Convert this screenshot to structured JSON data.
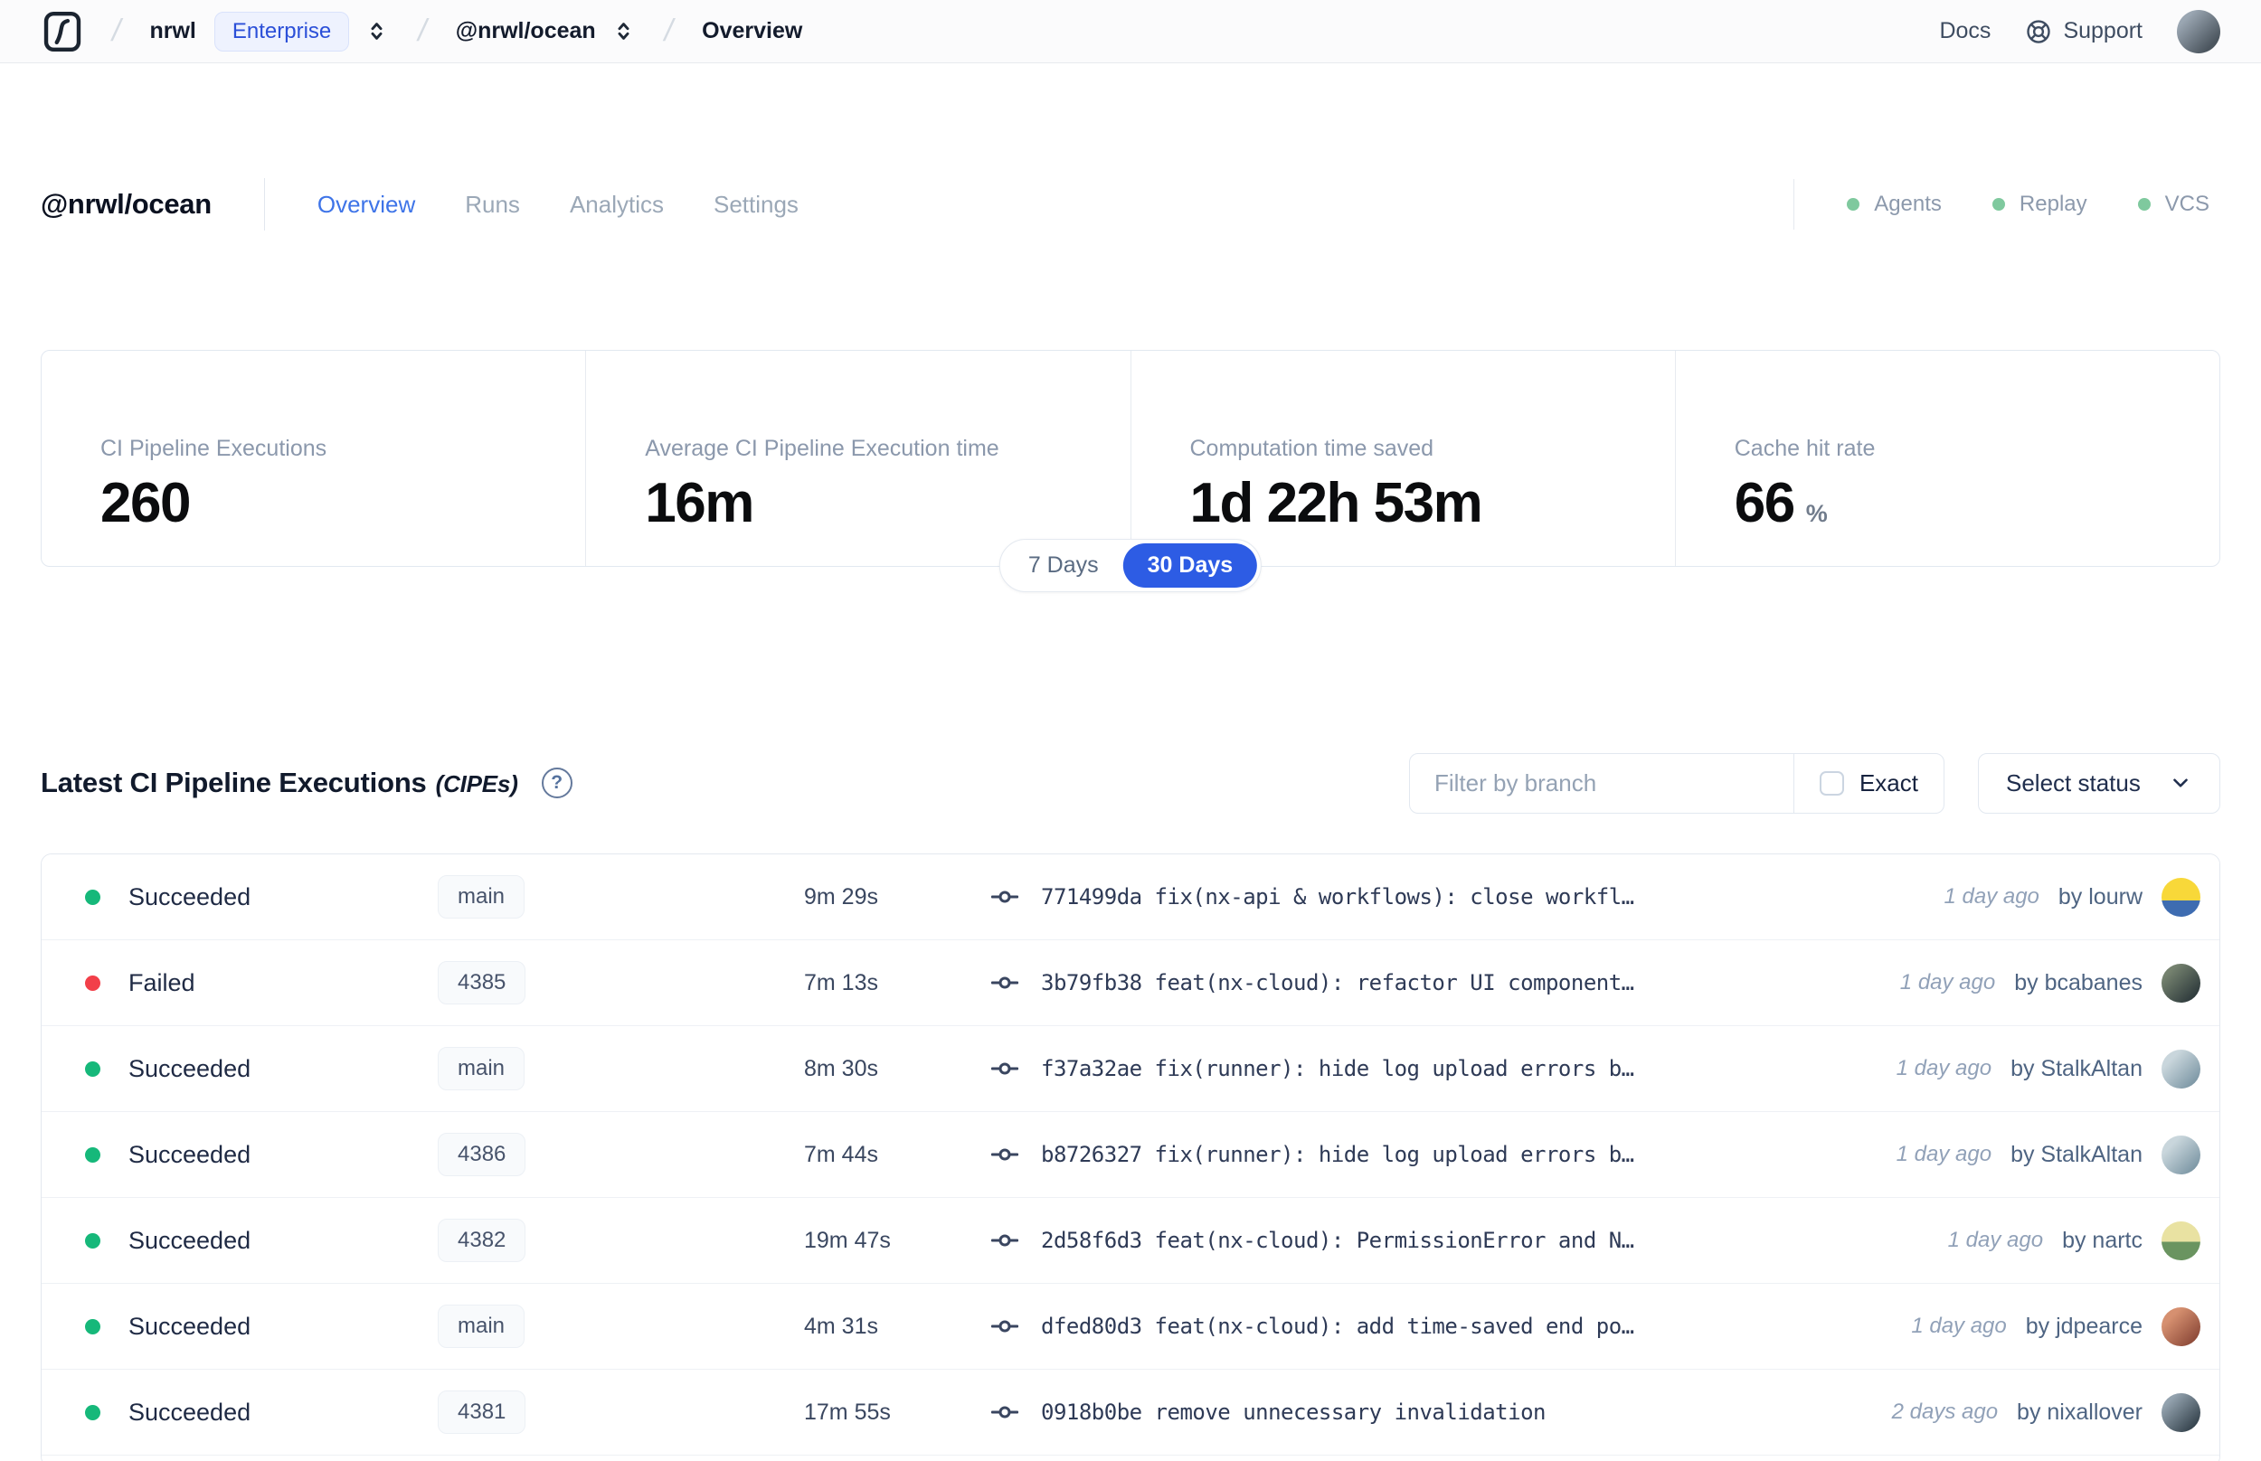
{
  "navbar": {
    "org": "nrwl",
    "org_badge": "Enterprise",
    "workspace": "@nrwl/ocean",
    "page": "Overview",
    "docs_label": "Docs",
    "support_label": "Support"
  },
  "workspace_header": {
    "title": "@nrwl/ocean",
    "tabs": [
      {
        "label": "Overview"
      },
      {
        "label": "Runs"
      },
      {
        "label": "Analytics"
      },
      {
        "label": "Settings"
      }
    ],
    "integrations": [
      {
        "label": "Agents"
      },
      {
        "label": "Replay"
      },
      {
        "label": "VCS"
      }
    ]
  },
  "stats": [
    {
      "label": "CI Pipeline Executions",
      "value": "260"
    },
    {
      "label": "Average CI Pipeline Execution time",
      "value": "16m"
    },
    {
      "label": "Computation time saved",
      "value": "1d 22h 53m"
    },
    {
      "label": "Cache hit rate",
      "value": "66",
      "suffix": "%"
    }
  ],
  "time_toggle": {
    "option_7": "7 Days",
    "option_30": "30 Days",
    "selected": "30 Days"
  },
  "cipe": {
    "title": "Latest CI Pipeline Executions",
    "title_suffix": "(CIPEs)",
    "filter_placeholder": "Filter by branch",
    "exact_label": "Exact",
    "select_status_label": "Select status"
  },
  "table": {
    "rows": [
      {
        "status": "Succeeded",
        "dot_style": "background:#16B87A",
        "branch": "main",
        "duration": "9m 29s",
        "commit_hash": "771499da",
        "commit_message": "fix(nx-api & workflows): close workfl…",
        "time": "1 day ago",
        "author": "by lourw",
        "avatar_style": "background:linear-gradient(180deg,#F8D839 58%,#3E6CB1 58%)"
      },
      {
        "status": "Failed",
        "dot_style": "background:#F23F49",
        "branch": "4385",
        "duration": "7m 13s",
        "commit_hash": "3b79fb38",
        "commit_message": "feat(nx-cloud): refactor UI component…",
        "time": "1 day ago",
        "author": "by bcabanes",
        "avatar_style": "background:linear-gradient(135deg,#75826F 20%,#2E3A3C 85%)"
      },
      {
        "status": "Succeeded",
        "dot_style": "background:#16B87A",
        "branch": "main",
        "duration": "8m 30s",
        "commit_hash": "f37a32ae",
        "commit_message": "fix(runner): hide log upload errors b…",
        "time": "1 day ago",
        "author": "by StalkAltan",
        "avatar_style": "background:linear-gradient(135deg,#C9D6DC 25%,#7E98A6 85%)"
      },
      {
        "status": "Succeeded",
        "dot_style": "background:#16B87A",
        "branch": "4386",
        "duration": "7m 44s",
        "commit_hash": "b8726327",
        "commit_message": "fix(runner): hide log upload errors b…",
        "time": "1 day ago",
        "author": "by StalkAltan",
        "avatar_style": "background:linear-gradient(135deg,#C9D6DC 25%,#7E98A6 85%)"
      },
      {
        "status": "Succeeded",
        "dot_style": "background:#16B87A",
        "branch": "4382",
        "duration": "19m 47s",
        "commit_hash": "2d58f6d3",
        "commit_message": "feat(nx-cloud): PermissionError and N…",
        "time": "1 day ago",
        "author": "by nartc",
        "avatar_style": "background:linear-gradient(180deg,#E9E2A2 52%,#6A9460 52%)"
      },
      {
        "status": "Succeeded",
        "dot_style": "background:#16B87A",
        "branch": "main",
        "duration": "4m 31s",
        "commit_hash": "dfed80d3",
        "commit_message": "feat(nx-cloud): add time-saved end po…",
        "time": "1 day ago",
        "author": "by jdpearce",
        "avatar_style": "background:linear-gradient(135deg,#D69070 25%,#8E4B3A 85%)"
      },
      {
        "status": "Succeeded",
        "dot_style": "background:#16B87A",
        "branch": "4381",
        "duration": "17m 55s",
        "commit_hash": "0918b0be",
        "commit_message": "remove unnecessary invalidation",
        "time": "2 days ago",
        "author": "by nixallover",
        "avatar_style": "background:linear-gradient(135deg,#93A2AE 20%,#36444E 85%)"
      }
    ]
  },
  "colors": {
    "accent_blue": "#2D5CE4",
    "success_green": "#16B87A",
    "error_red": "#F23F49",
    "integration_green": "#7FC99E"
  }
}
